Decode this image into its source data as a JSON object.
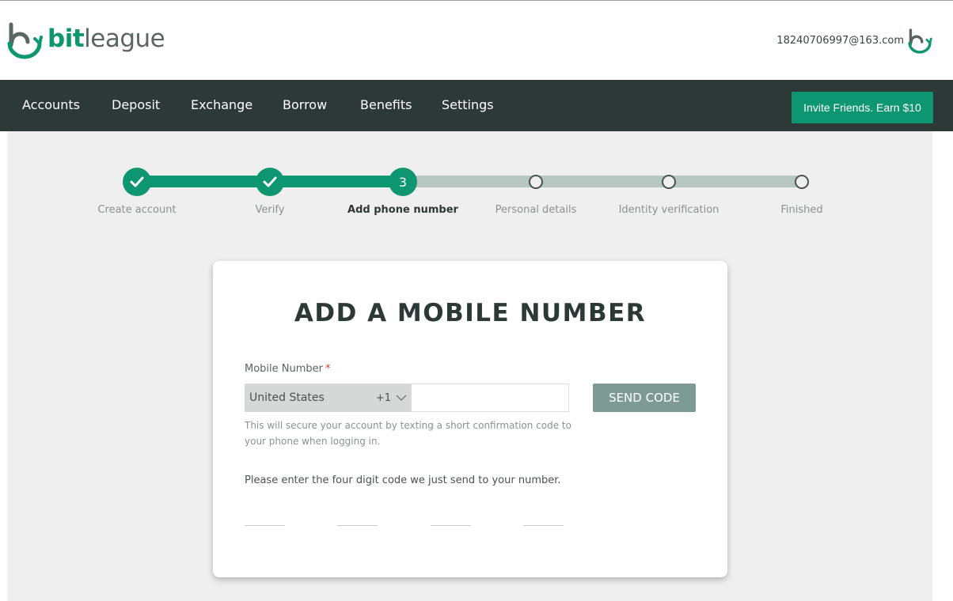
{
  "brand": {
    "name_bold": "bit",
    "name_light": "league",
    "color": "#0e9670"
  },
  "user": {
    "email": "18240706997@163.com",
    "avatar_icon": "bitleague-logo-icon"
  },
  "nav": {
    "items": [
      {
        "label": "Accounts"
      },
      {
        "label": "Deposit"
      },
      {
        "label": "Exchange"
      },
      {
        "label": "Borrow"
      },
      {
        "label": "Benefits"
      },
      {
        "label": "Settings"
      }
    ],
    "invite_label": "Invite Friends. Earn $10"
  },
  "stepper": {
    "current_step": 3,
    "steps": [
      {
        "label": "Create account",
        "status": "done"
      },
      {
        "label": "Verify",
        "status": "done"
      },
      {
        "label": "Add phone number",
        "status": "current",
        "number": "3"
      },
      {
        "label": "Personal details",
        "status": "pending"
      },
      {
        "label": "Identity verification",
        "status": "pending"
      },
      {
        "label": "Finished",
        "status": "pending"
      }
    ]
  },
  "form": {
    "title": "ADD A MOBILE NUMBER",
    "mobile_label": "Mobile Number",
    "required_mark": "*",
    "country": "United States",
    "dial_code": "+1",
    "phone_value": "",
    "send_code_label": "SEND CODE",
    "helper_text": "This will secure your account by texting a short confirmation code to your phone when logging in.",
    "code_prompt": "Please enter the four digit code we just send to your number.",
    "code_digits": [
      "",
      "",
      "",
      ""
    ]
  },
  "colors": {
    "nav_bg": "#2d3937",
    "accent": "#0e9670",
    "track_pending": "#b6c6c1",
    "send_btn": "#7e9a94"
  }
}
